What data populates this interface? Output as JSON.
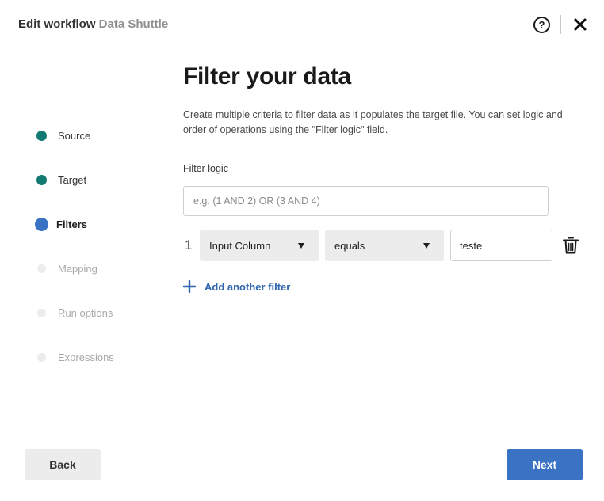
{
  "header": {
    "title_prefix": "Edit workflow",
    "workflow_name": "Data Shuttle",
    "help_label": "?"
  },
  "steps": [
    {
      "label": "Source",
      "state": "done"
    },
    {
      "label": "Target",
      "state": "done"
    },
    {
      "label": "Filters",
      "state": "current"
    },
    {
      "label": "Mapping",
      "state": "pending"
    },
    {
      "label": "Run options",
      "state": "pending"
    },
    {
      "label": "Expressions",
      "state": "pending"
    }
  ],
  "main": {
    "title": "Filter your data",
    "description": "Create multiple criteria to filter data as it populates the target file. You can set logic and order of operations using the \"Filter logic\" field.",
    "filter_logic_label": "Filter logic",
    "filter_logic_placeholder": "e.g. (1 AND 2) OR (3 AND 4)",
    "filter_logic_value": "",
    "filters": [
      {
        "number": "1",
        "column": "Input Column",
        "operator": "equals",
        "value": "teste"
      }
    ],
    "add_filter_label": "Add another filter"
  },
  "footer": {
    "back_label": "Back",
    "next_label": "Next"
  },
  "colors": {
    "primary": "#3a72c4",
    "step_done": "#127a72",
    "link": "#2f66b0"
  },
  "icons": {
    "help": "help-circle-icon",
    "close": "close-icon",
    "delete": "trash-icon",
    "add": "plus-icon",
    "dropdown": "caret-down-icon"
  }
}
